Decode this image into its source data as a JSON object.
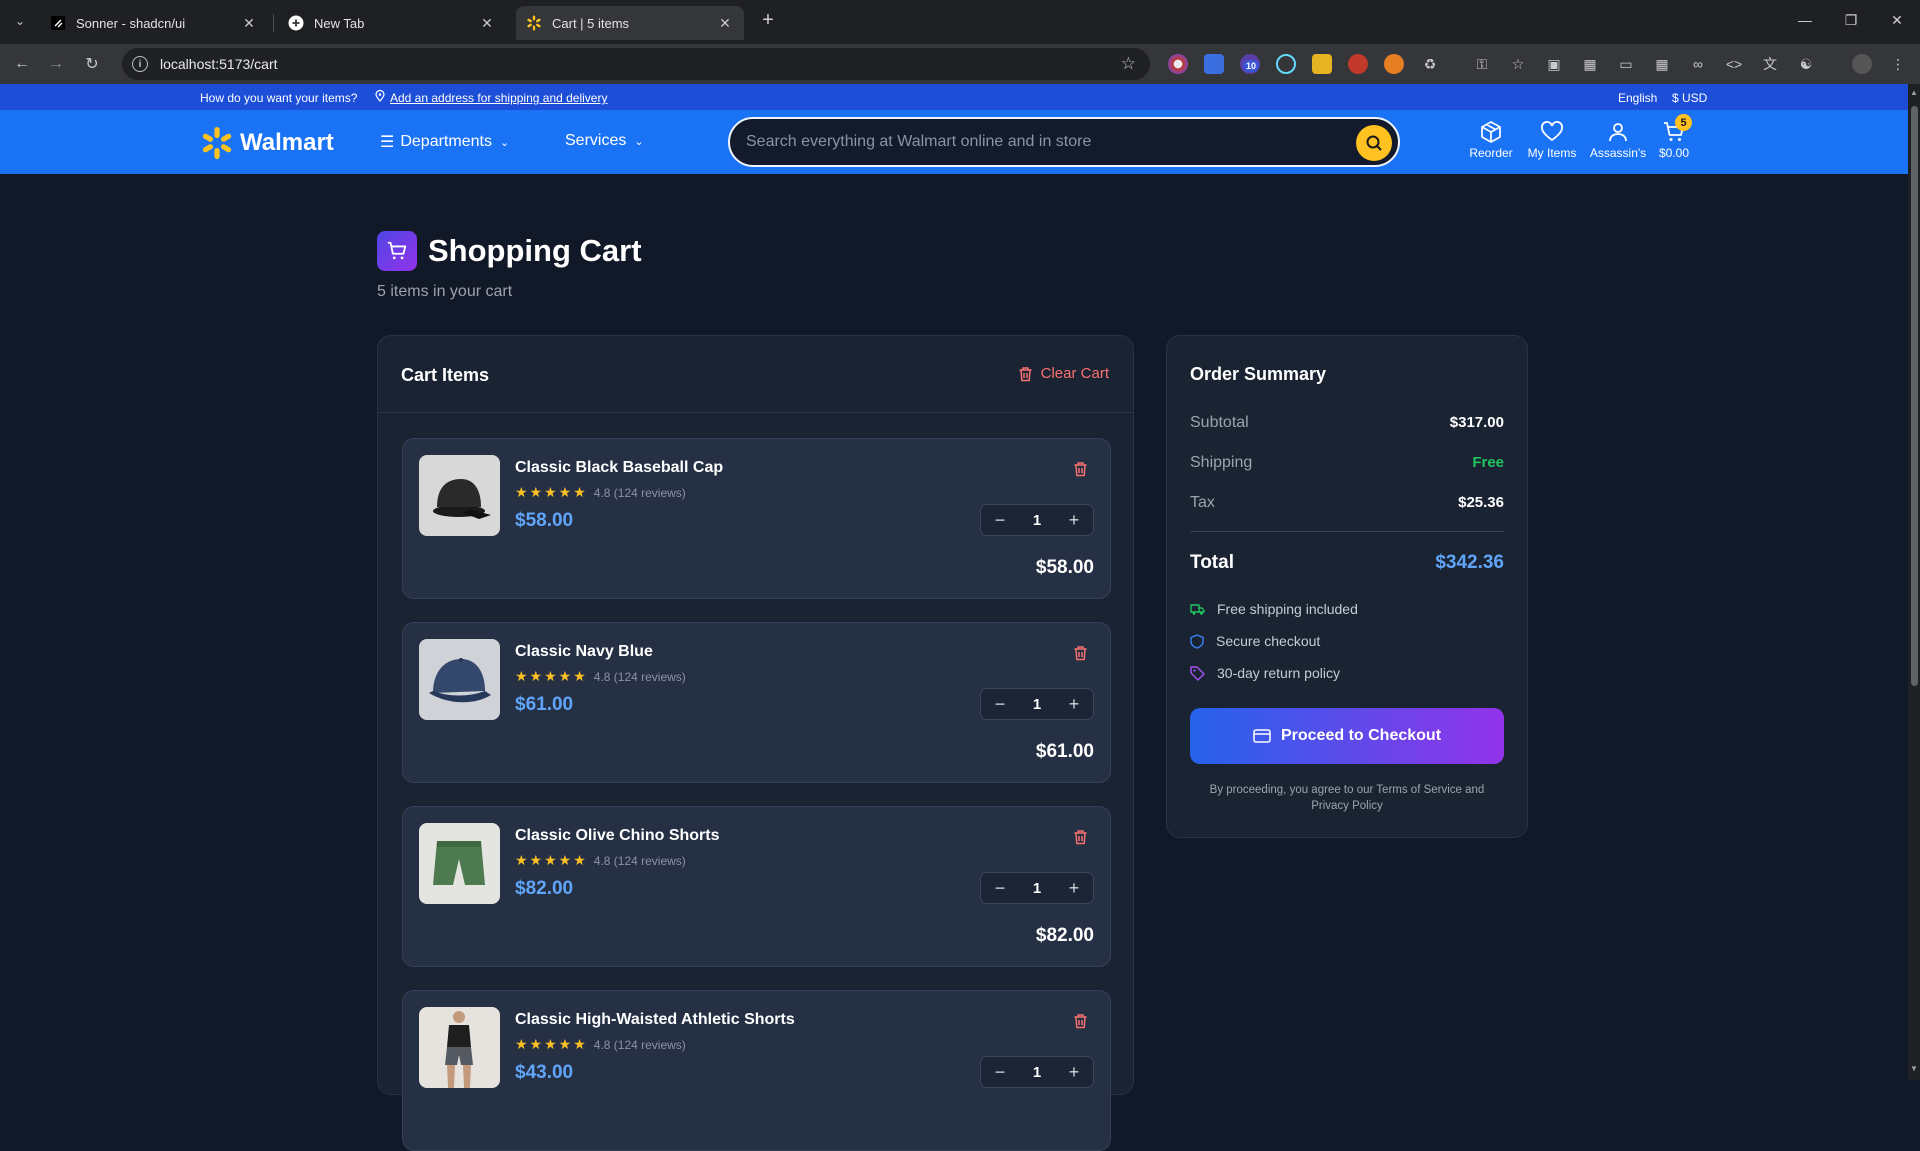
{
  "browser": {
    "tabs": [
      {
        "title": "Sonner - shadcn/ui",
        "icon": "shadcn-icon"
      },
      {
        "title": "New Tab",
        "icon": "chrome-icon"
      },
      {
        "title": "Cart | 5 items",
        "icon": "walmart-spark-icon"
      }
    ],
    "url": "localhost:5173/cart",
    "extension_badge": "10"
  },
  "topstrip": {
    "question": "How do you want your items?",
    "address_link": "Add an address for shipping and delivery",
    "language": "English",
    "currency": "$ USD"
  },
  "header": {
    "logo": "Walmart",
    "departments": "Departments",
    "services": "Services",
    "search_placeholder": "Search everything at Walmart online and in store",
    "reorder": "Reorder",
    "my_items": "My Items",
    "account": "Assassin's",
    "cart_total": "$0.00",
    "cart_count": "5"
  },
  "page": {
    "title": "Shopping Cart",
    "subtitle": "5 items in your cart"
  },
  "cart": {
    "heading": "Cart Items",
    "clear_label": "Clear Cart",
    "items": [
      {
        "name": "Classic Black Baseball Cap",
        "rating": "4.8 (124 reviews)",
        "price": "$58.00",
        "qty": "1",
        "line_total": "$58.00",
        "stars": 5
      },
      {
        "name": "Classic Navy Blue",
        "rating": "4.8 (124 reviews)",
        "price": "$61.00",
        "qty": "1",
        "line_total": "$61.00",
        "stars": 5
      },
      {
        "name": "Classic Olive Chino Shorts",
        "rating": "4.8 (124 reviews)",
        "price": "$82.00",
        "qty": "1",
        "line_total": "$82.00",
        "stars": 5
      },
      {
        "name": "Classic High-Waisted Athletic Shorts",
        "rating": "4.8 (124 reviews)",
        "price": "$43.00",
        "qty": "1",
        "line_total": "",
        "stars": 5
      }
    ]
  },
  "summary": {
    "title": "Order Summary",
    "subtotal_label": "Subtotal",
    "subtotal": "$317.00",
    "shipping_label": "Shipping",
    "shipping": "Free",
    "tax_label": "Tax",
    "tax": "$25.36",
    "total_label": "Total",
    "total": "$342.36",
    "perks": [
      "Free shipping included",
      "Secure checkout",
      "30-day return policy"
    ],
    "checkout_label": "Proceed to Checkout",
    "legal": "By proceeding, you agree to our Terms of Service and Privacy Policy"
  },
  "colors": {
    "brand_blue": "#1a73f5",
    "spark_yellow": "#ffc220",
    "price_blue": "#60a5fa",
    "free_green": "#22c55e",
    "danger_red": "#f87171"
  }
}
